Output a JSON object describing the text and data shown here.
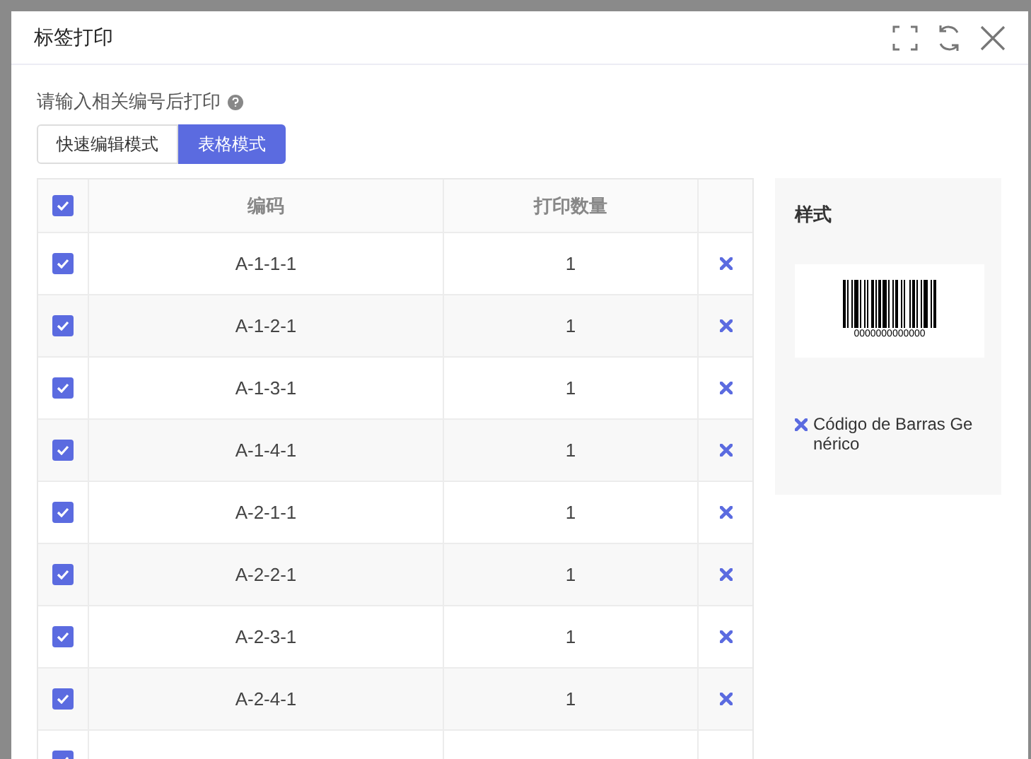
{
  "dialog": {
    "title": "标签打印"
  },
  "hint": "请输入相关编号后打印",
  "modes": [
    {
      "label": "快速编辑模式",
      "selected": false
    },
    {
      "label": "表格模式",
      "selected": true
    }
  ],
  "table": {
    "select_all_checked": true,
    "columns": [
      "编码",
      "打印数量"
    ],
    "rows": [
      {
        "code": "A-1-1-1",
        "quantity": "1",
        "checked": true
      },
      {
        "code": "A-1-2-1",
        "quantity": "1",
        "checked": true
      },
      {
        "code": "A-1-3-1",
        "quantity": "1",
        "checked": true
      },
      {
        "code": "A-1-4-1",
        "quantity": "1",
        "checked": true
      },
      {
        "code": "A-2-1-1",
        "quantity": "1",
        "checked": true
      },
      {
        "code": "A-2-2-1",
        "quantity": "1",
        "checked": true
      },
      {
        "code": "A-2-3-1",
        "quantity": "1",
        "checked": true
      },
      {
        "code": "A-2-4-1",
        "quantity": "1",
        "checked": true
      },
      {
        "checked": true
      }
    ]
  },
  "style_panel": {
    "title": "样式",
    "barcode_number": "0000000000000",
    "style_name": "Código de Barras Genérico"
  }
}
